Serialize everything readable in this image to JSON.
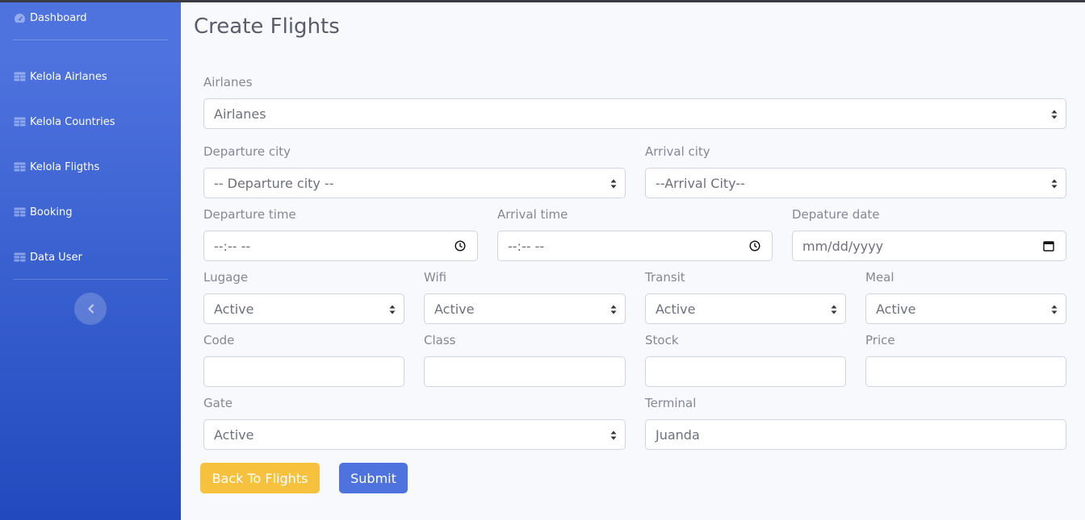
{
  "sidebar": {
    "dashboard_label": "Dashboard",
    "items": [
      {
        "label": "Kelola Airlanes",
        "icon": "table-icon"
      },
      {
        "label": "Kelola Countries",
        "icon": "table-icon"
      },
      {
        "label": "Kelola Fligths",
        "icon": "table-icon"
      },
      {
        "label": "Booking",
        "icon": "table-icon"
      },
      {
        "label": "Data User",
        "icon": "table-icon"
      }
    ],
    "toggle_icon": "chevron-left-icon"
  },
  "page": {
    "title": "Create Flights"
  },
  "form": {
    "airlanes": {
      "label": "Airlanes",
      "value": "Airlanes"
    },
    "departure_city": {
      "label": "Departure city",
      "value": "-- Departure city --"
    },
    "arrival_city": {
      "label": "Arrival city",
      "value": "--Arrival City--"
    },
    "departure_time": {
      "label": "Departure time",
      "value": "--:-- --"
    },
    "arrival_time": {
      "label": "Arrival time",
      "value": "--:-- --"
    },
    "departure_date": {
      "label": "Depature date",
      "value": "mm/dd/yyyy"
    },
    "lugage": {
      "label": "Lugage",
      "value": "Active"
    },
    "wifi": {
      "label": "Wifi",
      "value": "Active"
    },
    "transit": {
      "label": "Transit",
      "value": "Active"
    },
    "meal": {
      "label": "Meal",
      "value": "Active"
    },
    "code": {
      "label": "Code",
      "value": ""
    },
    "class": {
      "label": "Class",
      "value": ""
    },
    "stock": {
      "label": "Stock",
      "value": ""
    },
    "price": {
      "label": "Price",
      "value": ""
    },
    "gate": {
      "label": "Gate",
      "value": "Active"
    },
    "terminal": {
      "label": "Terminal",
      "placeholder": "Juanda"
    }
  },
  "buttons": {
    "back": "Back To Flights",
    "submit": "Submit"
  },
  "colors": {
    "primary": "#4e73df",
    "warning": "#f6c23e",
    "sidebar_start": "#4e73df",
    "sidebar_end": "#224abe"
  }
}
